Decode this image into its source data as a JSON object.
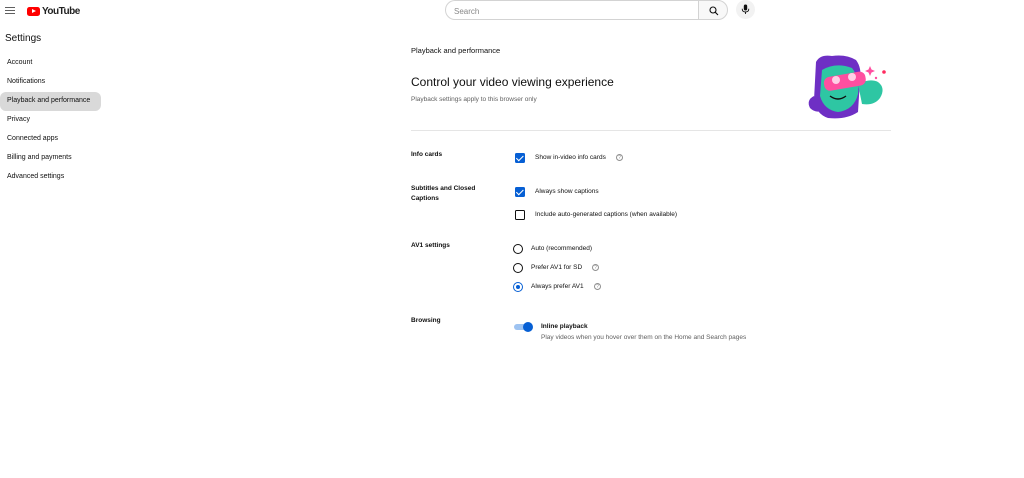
{
  "header": {
    "logo_text": "YouTube",
    "search_placeholder": "Search",
    "icons": [
      "menu-icon",
      "search-icon",
      "mic-icon"
    ]
  },
  "sidebar": {
    "title": "Settings",
    "items": [
      {
        "label": "Account",
        "active": false
      },
      {
        "label": "Notifications",
        "active": false
      },
      {
        "label": "Playback and performance",
        "active": true
      },
      {
        "label": "Privacy",
        "active": false
      },
      {
        "label": "Connected apps",
        "active": false
      },
      {
        "label": "Billing and payments",
        "active": false
      },
      {
        "label": "Advanced settings",
        "active": false
      }
    ]
  },
  "main": {
    "section": "Playback and performance",
    "heading": "Control your video viewing experience",
    "subheading": "Playback settings apply to this browser only",
    "info_cards": {
      "label": "Info cards",
      "option": {
        "label": "Show in-video info cards",
        "checked": true
      }
    },
    "captions": {
      "label": "Subtitles and Closed Captions",
      "label_line1": "Subtitles and Closed",
      "label_line2": "Captions",
      "options": [
        {
          "label": "Always show captions",
          "checked": true
        },
        {
          "label": "Include auto-generated captions (when available)",
          "checked": false
        }
      ]
    },
    "av1": {
      "label": "AV1 settings",
      "options": [
        {
          "label": "Auto (recommended)",
          "selected": false
        },
        {
          "label": "Prefer AV1 for SD",
          "selected": false
        },
        {
          "label": "Always prefer AV1",
          "selected": true
        }
      ]
    },
    "browsing": {
      "label": "Browsing",
      "toggle_title": "Inline playback",
      "toggle_desc": "Play videos when you hover over them on the Home and Search pages",
      "enabled": true
    }
  },
  "colors": {
    "accent": "#065fd4",
    "brand": "#ff0000",
    "active_nav": "#d9d9d9",
    "illustration_purple": "#6e2fc4",
    "illustration_teal": "#2ec6a3",
    "illustration_pink": "#ff4fa0"
  }
}
